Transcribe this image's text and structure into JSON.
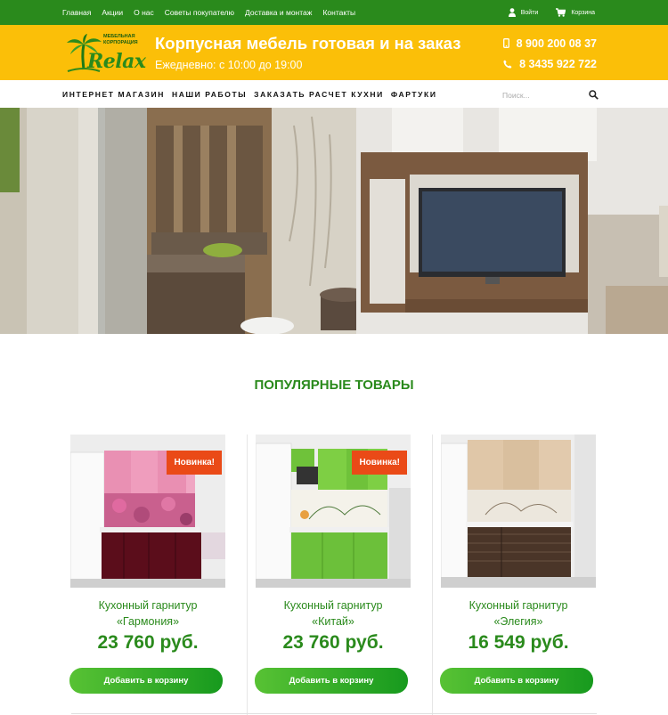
{
  "topbar": {
    "links": [
      "Главная",
      "Акции",
      "О нас",
      "Советы покупателю",
      "Доставка и монтаж",
      "Контакты"
    ],
    "login_label": "Войти",
    "cart_label": "Корзина"
  },
  "header": {
    "logo_subtitle": "МЕБЕЛЬНАЯ КОРПОРАЦИЯ",
    "logo_brand": "Relax",
    "slogan": "Корпусная мебель готовая и на заказ",
    "hours": "Ежедневно: с 10:00 до 19:00",
    "phone1": "8 900 200 08 37",
    "phone2": "8 3435 922 722"
  },
  "nav": {
    "links": [
      "ИНТЕРНЕТ МАГАЗИН",
      "НАШИ РАБОТЫ",
      "ЗАКАЗАТЬ РАСЧЕТ КУХНИ",
      "ФАРТУКИ"
    ],
    "search_placeholder": "Поиск..."
  },
  "section": {
    "title": "ПОПУЛЯРНЫЕ ТОВАРЫ"
  },
  "products": [
    {
      "name_line1": "Кухонный гарнитур",
      "name_line2": "«Гармония»",
      "price": "23 760 руб.",
      "badge": "Новинка!",
      "button": "Добавить в корзину"
    },
    {
      "name_line1": "Кухонный гарнитур",
      "name_line2": "«Китай»",
      "price": "23 760 руб.",
      "badge": "Новинка!",
      "button": "Добавить в корзину"
    },
    {
      "name_line1": "Кухонный гарнитур",
      "name_line2": "«Элегия»",
      "price": "16 549 руб.",
      "button": "Добавить в корзину"
    }
  ],
  "colors": {
    "green": "#2a8a1c",
    "yellow": "#fbbf08",
    "badge": "#ea4a17"
  }
}
